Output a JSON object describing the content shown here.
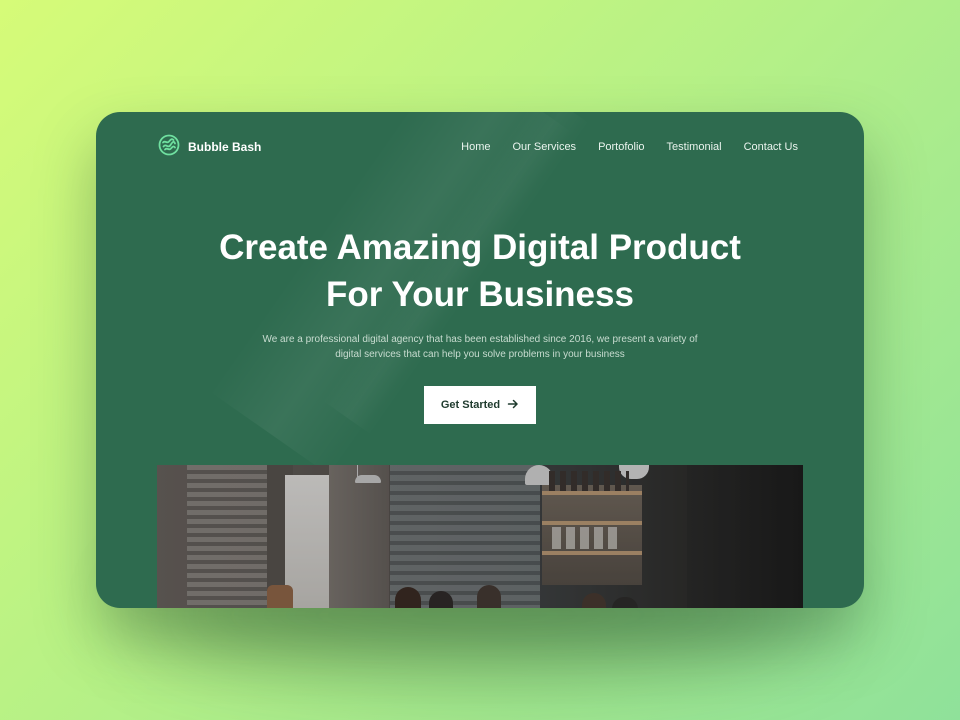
{
  "brand": {
    "name": "Bubble Bash",
    "logo_icon": "bubble-logo-icon"
  },
  "nav": {
    "items": [
      {
        "label": "Home"
      },
      {
        "label": "Our Services"
      },
      {
        "label": "Portofolio"
      },
      {
        "label": "Testimonial"
      },
      {
        "label": "Contact Us"
      }
    ]
  },
  "hero": {
    "title_line1": "Create Amazing Digital Product",
    "title_line2": "For Your Business",
    "subtitle_line1": "We are a professional digital agency that has been established since 2016, we present a variety of",
    "subtitle_line2": "digital services that can help you solve problems in your business",
    "cta_label": "Get Started",
    "cta_icon": "arrow-right-icon"
  },
  "colors": {
    "background_start": "#d6fb78",
    "background_end": "#8fe19a",
    "card": "#2e6b4f",
    "accent": "#6fe0a0",
    "button": "#ffffff"
  }
}
